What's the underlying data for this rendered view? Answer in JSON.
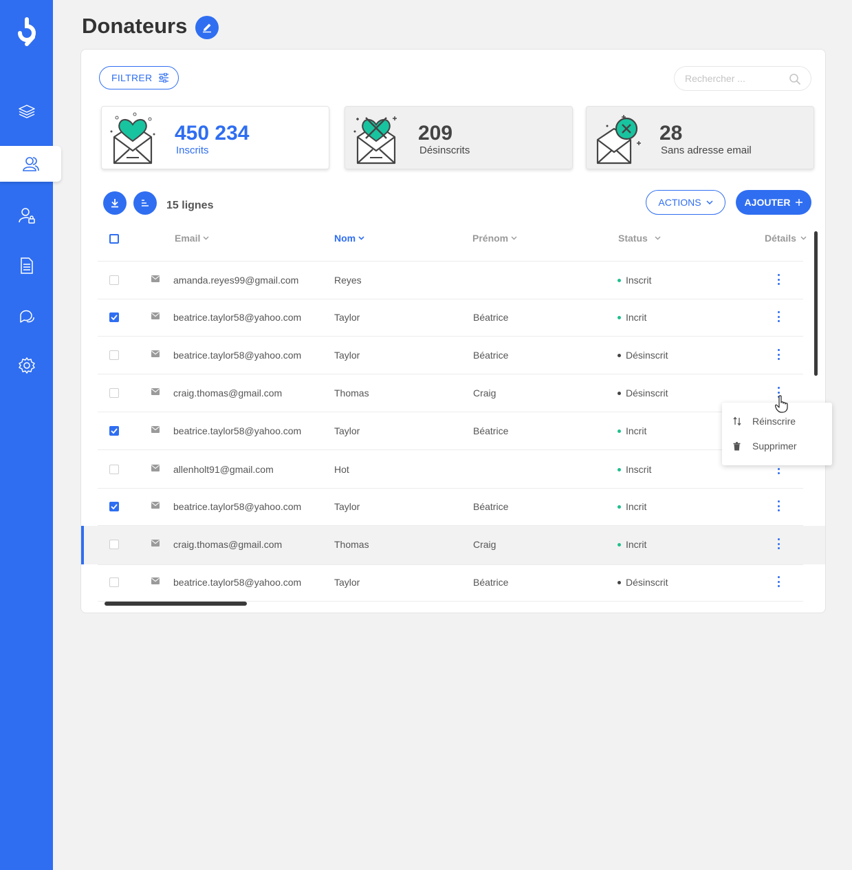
{
  "page": {
    "title": "Donateurs"
  },
  "sidebar": {
    "items": [
      {
        "icon": "layers-icon"
      },
      {
        "icon": "users-icon",
        "active": true
      },
      {
        "icon": "user-lock-icon"
      },
      {
        "icon": "document-icon"
      },
      {
        "icon": "chat-icon"
      },
      {
        "icon": "gear-icon"
      }
    ]
  },
  "toolbar": {
    "filter_label": "FILTRER",
    "search_placeholder": "Rechercher ..."
  },
  "stats": [
    {
      "value": "450 234",
      "label": "Inscrits"
    },
    {
      "value": "209",
      "label": "Désinscrits"
    },
    {
      "value": "28",
      "label": "Sans adresse email"
    }
  ],
  "table_toolbar": {
    "row_count": "15 lignes",
    "actions_label": "ACTIONS",
    "add_label": "AJOUTER"
  },
  "table": {
    "headers": {
      "email": "Email",
      "nom": "Nom",
      "prenom": "Prénom",
      "status": "Status",
      "details": "Détails"
    },
    "rows": [
      {
        "checked": false,
        "email": "amanda.reyes99@gmail.com",
        "nom": "Reyes",
        "prenom": "",
        "status": "Inscrit",
        "status_color": "#1fbf8f"
      },
      {
        "checked": true,
        "email": "beatrice.taylor58@yahoo.com",
        "nom": "Taylor",
        "prenom": "Béatrice",
        "status": "Incrit",
        "status_color": "#1fbf8f"
      },
      {
        "checked": false,
        "email": "beatrice.taylor58@yahoo.com",
        "nom": "Taylor",
        "prenom": "Béatrice",
        "status": "Désinscrit",
        "status_color": "#444444"
      },
      {
        "checked": false,
        "email": "craig.thomas@gmail.com",
        "nom": "Thomas",
        "prenom": "Craig",
        "status": "Désinscrit",
        "status_color": "#444444"
      },
      {
        "checked": true,
        "email": "beatrice.taylor58@yahoo.com",
        "nom": "Taylor",
        "prenom": "Béatrice",
        "status": "Incrit",
        "status_color": "#1fbf8f"
      },
      {
        "checked": false,
        "email": "allenholt91@gmail.com",
        "nom": "Hot",
        "prenom": "",
        "status": "Inscrit",
        "status_color": "#1fbf8f"
      },
      {
        "checked": true,
        "email": "beatrice.taylor58@yahoo.com",
        "nom": "Taylor",
        "prenom": "Béatrice",
        "status": "Incrit",
        "status_color": "#1fbf8f"
      },
      {
        "checked": false,
        "email": "craig.thomas@gmail.com",
        "nom": "Thomas",
        "prenom": "Craig",
        "status": "Incrit",
        "status_color": "#1fbf8f",
        "highlighted": true
      },
      {
        "checked": false,
        "email": "beatrice.taylor58@yahoo.com",
        "nom": "Taylor",
        "prenom": "Béatrice",
        "status": "Désinscrit",
        "status_color": "#444444"
      }
    ]
  },
  "context_menu": {
    "items": [
      {
        "label": "Réinscrire",
        "icon": "swap-vertical-icon"
      },
      {
        "label": "Supprimer",
        "icon": "trash-icon"
      }
    ]
  },
  "colors": {
    "accent": "#2f6ef1",
    "inscrit": "#1fbf8f",
    "teal": "#18c4a0"
  }
}
